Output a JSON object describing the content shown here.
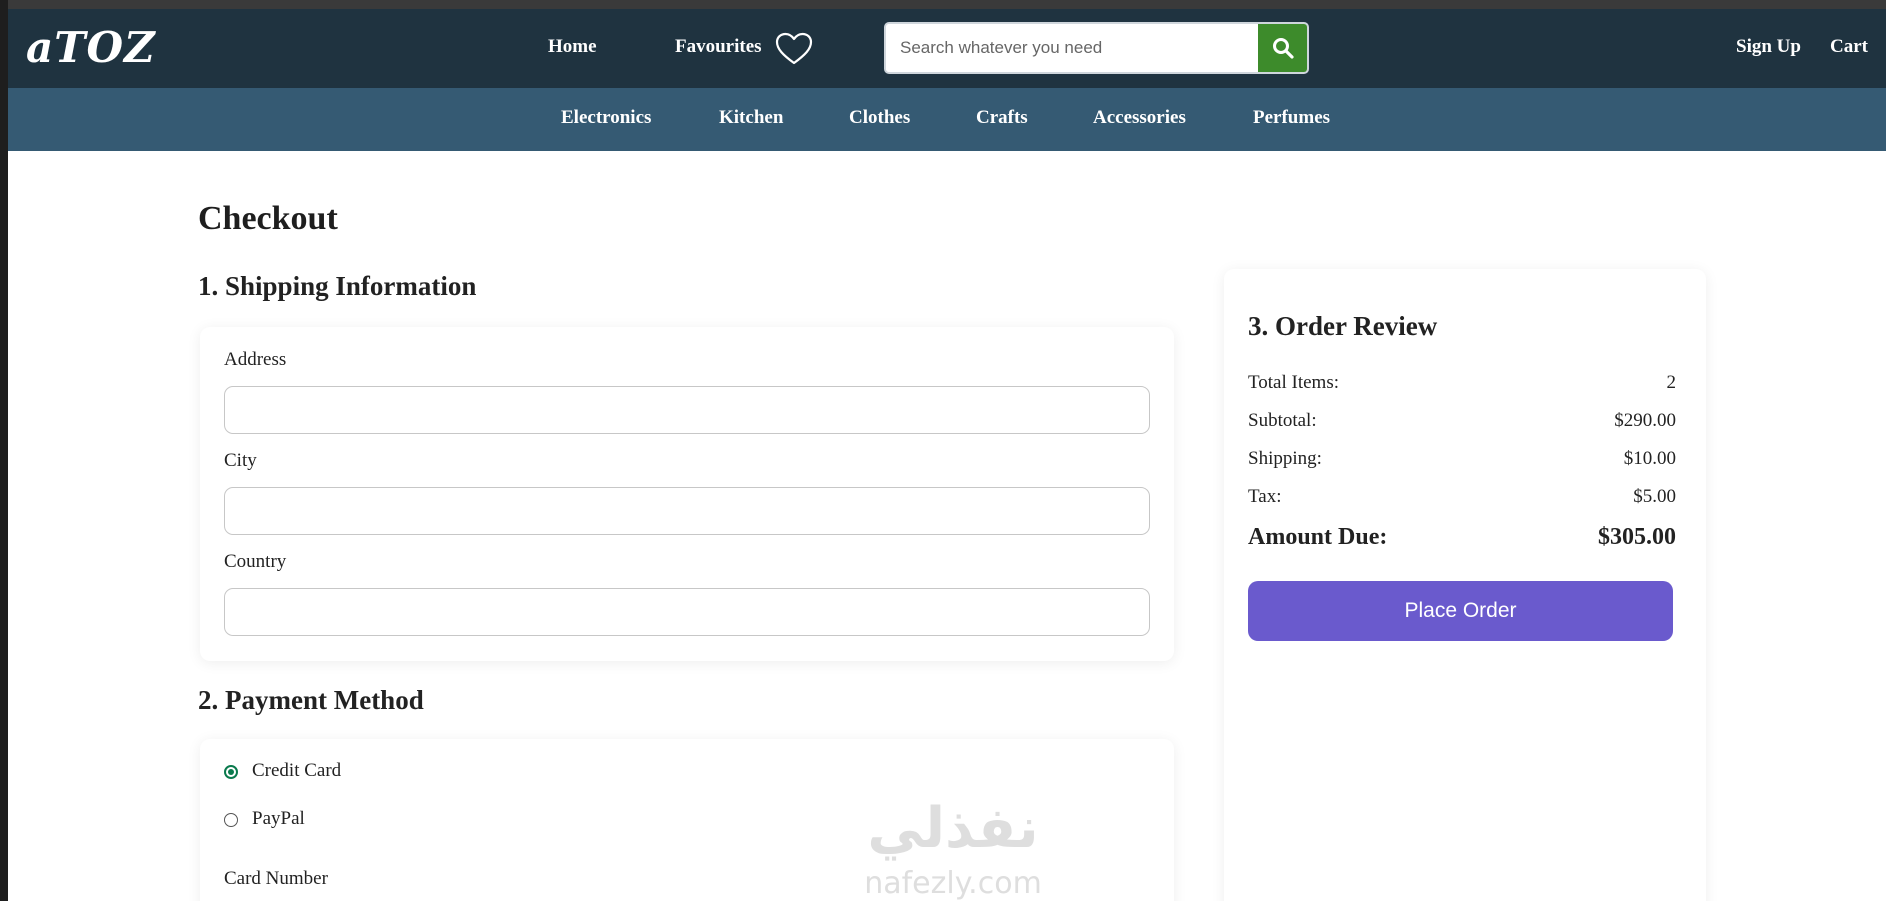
{
  "brand": {
    "logo_text": "aTOZ"
  },
  "header": {
    "nav": {
      "home": "Home",
      "favourites": "Favourites",
      "sign_up": "Sign Up",
      "cart": "Cart"
    },
    "search": {
      "placeholder": "Search whatever you need",
      "value": ""
    },
    "icons": {
      "favourites": "heart-icon",
      "search": "search-icon"
    }
  },
  "categories": [
    "Electronics",
    "Kitchen",
    "Clothes",
    "Crafts",
    "Accessories",
    "Perfumes"
  ],
  "checkout": {
    "title": "Checkout",
    "shipping": {
      "heading": "1. Shipping Information",
      "fields": [
        {
          "label": "Address",
          "value": ""
        },
        {
          "label": "City",
          "value": ""
        },
        {
          "label": "Country",
          "value": ""
        }
      ]
    },
    "payment": {
      "heading": "2. Payment Method",
      "options": [
        {
          "label": "Credit Card",
          "selected": true
        },
        {
          "label": "PayPal",
          "selected": false
        }
      ],
      "card_number_label": "Card Number"
    },
    "review": {
      "heading": "3. Order Review",
      "rows": [
        {
          "label": "Total Items:",
          "value": "2"
        },
        {
          "label": "Subtotal:",
          "value": "$290.00"
        },
        {
          "label": "Shipping:",
          "value": "$10.00"
        },
        {
          "label": "Tax:",
          "value": "$5.00"
        }
      ],
      "amount_due_label": "Amount Due:",
      "amount_due_value": "$305.00",
      "place_order_label": "Place Order"
    }
  },
  "watermark": {
    "arabic": "نفذلي",
    "latin": "nafezly.com"
  },
  "colors": {
    "header": "#1f3340",
    "category_bar": "#355a73",
    "search_button": "#3d8b2b",
    "place_order": "#6a5acd",
    "radio_checked": "#0a7a4d"
  }
}
